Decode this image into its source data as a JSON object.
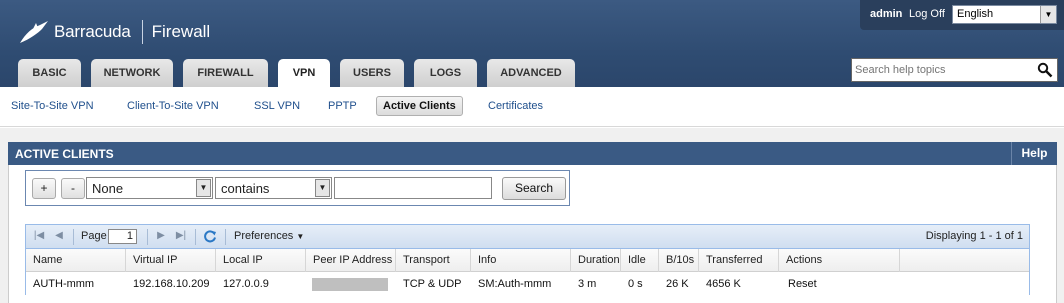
{
  "header": {
    "brand": "Barracuda",
    "product": "Firewall",
    "user": "admin",
    "logoff": "Log Off",
    "language": "English",
    "help_search_placeholder": "Search help topics"
  },
  "tabs": [
    "BASIC",
    "NETWORK",
    "FIREWALL",
    "VPN",
    "USERS",
    "LOGS",
    "ADVANCED"
  ],
  "active_tab": "VPN",
  "subnav": [
    "Site-To-Site VPN",
    "Client-To-Site VPN",
    "SSL VPN",
    "PPTP",
    "Active Clients",
    "Certificates"
  ],
  "active_subnav": "Active Clients",
  "panel": {
    "title": "ACTIVE CLIENTS",
    "help": "Help"
  },
  "filter": {
    "add": "+",
    "remove": "-",
    "field": "None",
    "operator": "contains",
    "value": "",
    "search": "Search"
  },
  "grid": {
    "page_label": "Page",
    "page": "1",
    "preferences": "Preferences",
    "displaying": "Displaying 1 - 1 of 1",
    "columns": [
      "Name",
      "Virtual IP",
      "Local IP",
      "Peer IP Address",
      "Transport",
      "Info",
      "Duration",
      "Idle",
      "B/10s",
      "Transferred",
      "Actions"
    ],
    "rows": [
      {
        "name": "AUTH-mmm",
        "virtual_ip": "192.168.10.209",
        "local_ip": "127.0.0.9",
        "transport": "TCP & UDP",
        "info": "SM:Auth-mmm",
        "duration": "3 m",
        "idle": "0 s",
        "b10s": "26 K",
        "transferred": "4656 K",
        "action": "Reset"
      }
    ]
  }
}
